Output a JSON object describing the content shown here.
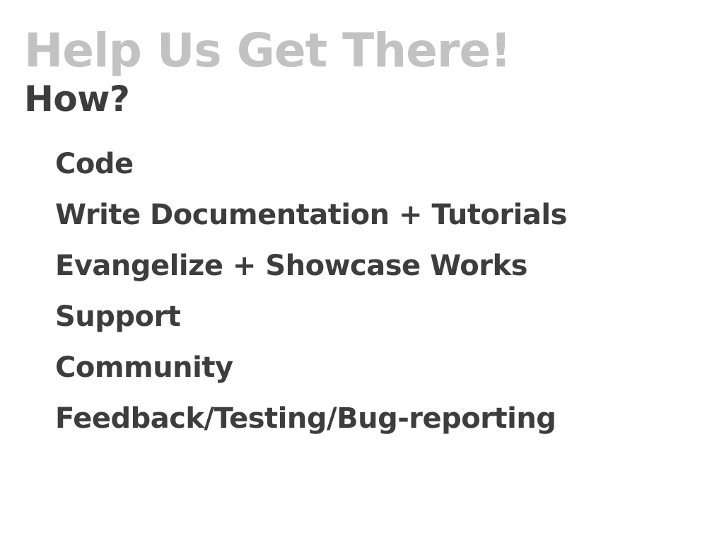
{
  "slide": {
    "title": "Help Us Get There!",
    "subtitle": "How?",
    "items": [
      "Code",
      "Write Documentation + Tutorials",
      "Evangelize + Showcase Works",
      "Support",
      "Community",
      "Feedback/Testing/Bug-reporting"
    ]
  },
  "colors": {
    "title": "#c2c2c2",
    "text": "#3d3d3d",
    "background": "#ffffff"
  }
}
